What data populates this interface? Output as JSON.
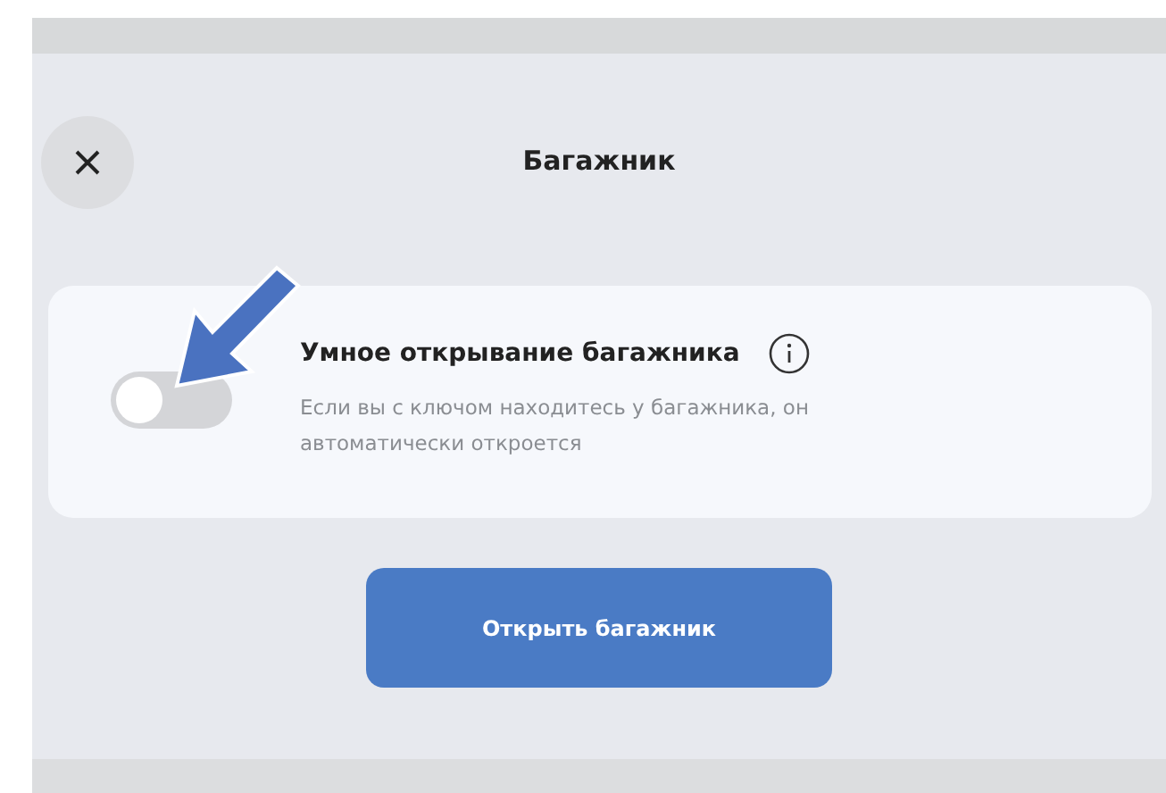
{
  "header": {
    "title": "Багажник"
  },
  "setting": {
    "title": "Умное открывание багажника",
    "description": "Если вы с ключом находитесь у багажника, он автоматически откроется",
    "on": false
  },
  "action_button": {
    "label": "Открыть багажник"
  }
}
